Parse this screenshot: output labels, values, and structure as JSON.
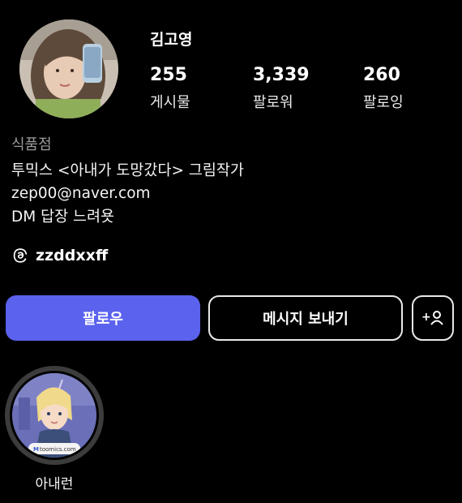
{
  "profile": {
    "name": "김고영",
    "category": "식품점",
    "bio": [
      "투믹스 <아내가 도망갔다> 그림작가",
      "zep00@naver.com",
      "DM 답장 느려욧"
    ],
    "threads_handle": "zzddxxff"
  },
  "stats": [
    {
      "value": "255",
      "label": "게시물"
    },
    {
      "value": "3,339",
      "label": "팔로워"
    },
    {
      "value": "260",
      "label": "팔로잉"
    }
  ],
  "buttons": {
    "follow": "팔로우",
    "message": "메시지 보내기",
    "add_person": "+"
  },
  "highlight": {
    "label": "아내런",
    "badge_text": "toomics.com",
    "badge_prefix": "M"
  },
  "colors": {
    "background": "#000000",
    "primary": "#5b62ee",
    "secondary_text": "#9b9b9b"
  }
}
